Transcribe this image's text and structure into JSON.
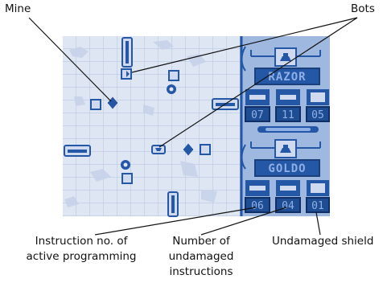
{
  "callouts": {
    "mine": "Mine",
    "bots": "Bots",
    "instruction_line1": "Instruction no. of",
    "instruction_line2": "active programming",
    "number_line1": "Number of",
    "number_line2": "undamaged",
    "number_line3": "instructions",
    "shield": "Undamaged shield"
  },
  "bot1": {
    "name": "RAZOR",
    "instruction_no": "07",
    "undamaged_instructions": "11",
    "shield": "05"
  },
  "bot2": {
    "name": "GOLDO",
    "instruction_no": "06",
    "undamaged_instructions": "04",
    "shield": "01"
  },
  "colors": {
    "ink": "#2457a6",
    "grid_bg": "#dfe6f3",
    "grid_line": "#b9c8e2",
    "panel_bg": "#9fb8e0"
  }
}
